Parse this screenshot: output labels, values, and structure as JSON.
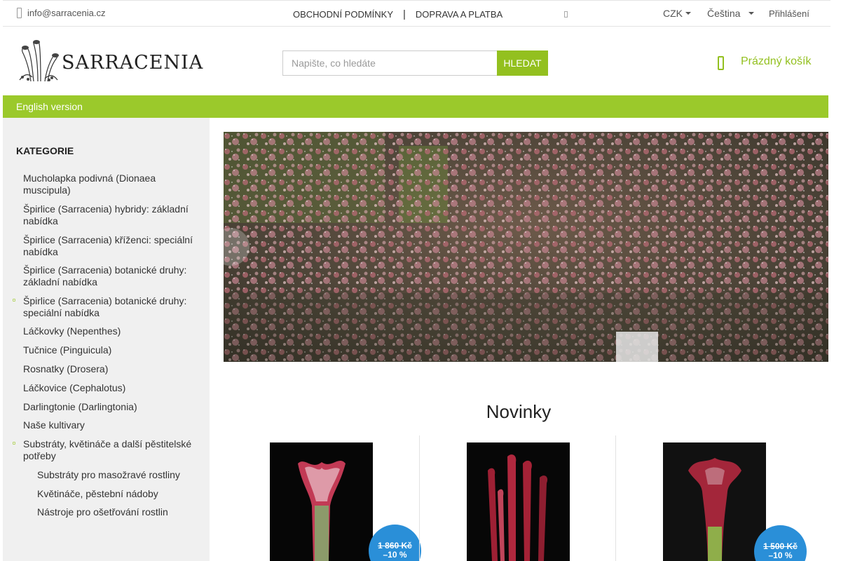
{
  "topbar": {
    "email": "info@sarracenia.cz",
    "links": [
      "OBCHODNÍ PODMÍNKY",
      "DOPRAVA A PLATBA"
    ],
    "separator": "|",
    "currency": "CZK",
    "language": "Čeština",
    "login": "Přihlášení"
  },
  "header": {
    "brand": "SARRACENIA",
    "search_placeholder": "Napište, co hledáte",
    "search_button": "HLEDAT",
    "cart_label": "Prázdný košík"
  },
  "greenbar": {
    "label": "English version"
  },
  "sidebar": {
    "heading": "KATEGORIE",
    "items": [
      "Mucholapka podivná (Dionaea muscipula)",
      "Špirlice (Sarracenia) hybridy: základní nabídka",
      "Špirlice (Sarracenia) kříženci: speciální nabídka",
      "Špirlice (Sarracenia) botanické druhy: základní nabídka",
      "Špirlice (Sarracenia) botanické druhy: speciální nabídka",
      "Láčkovky (Nepenthes)",
      "Tučnice (Pinguicula)",
      "Rosnatky (Drosera)",
      "Láčkovice (Cephalotus)",
      "Darlingtonie (Darlingtonia)",
      "Naše kultivary",
      "Substráty, květináče a další pěstitelské potřeby"
    ],
    "subitems": [
      "Substráty pro masožravé rostliny",
      "Květináče, pěstební nádoby",
      "Nástroje pro ošetřování rostlin"
    ]
  },
  "news": {
    "title": "Novinky",
    "products": [
      {
        "old_price": "1 860 Kč",
        "discount": "–10 %"
      },
      {
        "old_price": "",
        "discount": ""
      },
      {
        "old_price": "1 500 Kč",
        "discount": "–10 %"
      }
    ]
  },
  "colors": {
    "accent": "#93c01f",
    "greenbar": "#9bc92b",
    "badge": "#2a8fd8"
  }
}
